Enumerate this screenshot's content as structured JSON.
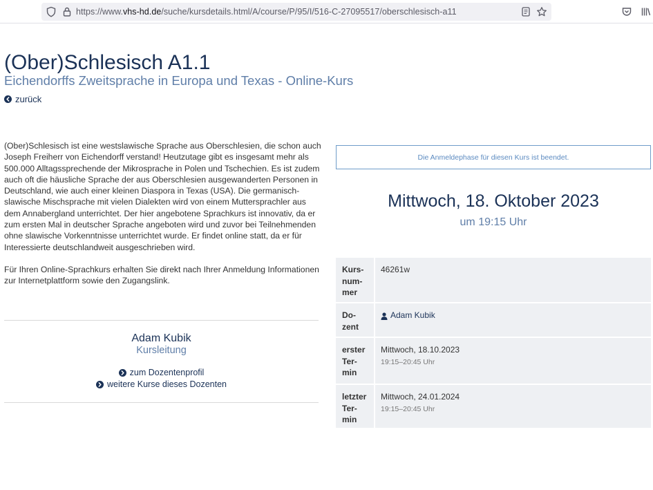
{
  "browser": {
    "url_prefix": "https://www.",
    "url_domain": "vhs-hd.de",
    "url_path": "/suche/kursdetails.html/A/course/P/95/I/516-C-27095517/oberschlesisch-a11",
    "icons": [
      "shield-icon",
      "lock-icon",
      "reader-view-icon",
      "bookmark-star-icon",
      "pocket-icon",
      "library-icon"
    ]
  },
  "header": {
    "title": "(Ober)Schlesisch A1.1",
    "subtitle": "Eichendorffs Zweitsprache in Europa und Texas - Online-Kurs",
    "back_label": "zurück"
  },
  "description": {
    "paragraphs": [
      "(Ober)Schlesisch ist eine westslawische Sprache aus Oberschlesien, die schon auch Joseph Freiherr von Eichendorff verstand! Heutzutage gibt es insgesamt mehr als 500.000 Alltagssprechende der Mikrosprache in Polen und Tschechien. Es ist zudem auch oft die häusliche Sprache der aus Oberschlesien ausgewanderten Personen in Deutschland, wie auch einer kleinen Diaspora in Texas (USA). Die germanisch-slawische Mischsprache mit vielen Dialekten wird von einem Muttersprachler aus dem Annabergland unterrichtet. Der hier angebotene Sprachkurs ist innovativ, da er zum ersten Mal in deutscher Sprache angeboten wird und zuvor bei Teilnehmenden ohne slawische Vorkenntnisse unterrichtet wurde. Er findet online statt, da er für Interessierte deutschlandweit ausgeschrieben wird.",
      "Für Ihren Online-Sprachkurs erhalten Sie direkt nach Ihrer Anmeldung Informationen zur Internetplattform sowie den Zugangslink."
    ]
  },
  "teacher": {
    "name": "Adam Kubik",
    "role": "Kursleitung",
    "profile_link": "zum Dozentenprofil",
    "more_courses_link": "weitere Kurse dieses Dozenten"
  },
  "notice": "Die Anmeldephase für diesen Kurs ist beendet.",
  "schedule": {
    "date": "Mittwoch, 18. Oktober 2023",
    "time": "um 19:15 Uhr"
  },
  "info_table": {
    "course_number_label": "Kurs-\nnum-\nmer",
    "course_number": "46261w",
    "teacher_label": "Do-\nzent",
    "teacher_name": "Adam Kubik",
    "first_label": "erster\nTer-\nmin",
    "first_date": "Mittwoch, 18.10.2023",
    "first_time": "19:15–20:45 Uhr",
    "last_label": "letzter\nTer-\nmin",
    "last_date": "Mittwoch, 24.01.2024",
    "last_time": "19:15–20:45 Uhr"
  },
  "colors": {
    "primary": "#1b3257",
    "secondary": "#5f7ea8",
    "notice_border": "#6e9cc9",
    "table_bg": "#eef0f3"
  }
}
